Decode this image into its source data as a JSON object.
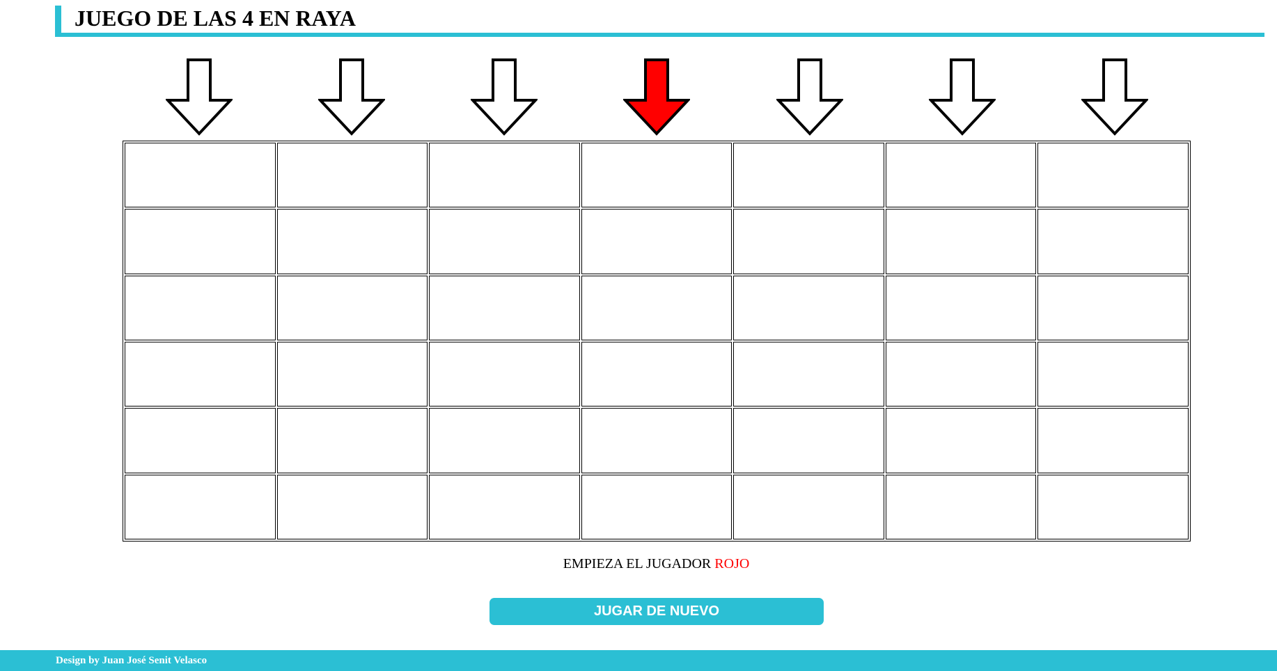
{
  "title": "JUEGO DE LAS 4 EN RAYA",
  "columns": [
    {
      "arrow": "down-arrow-icon",
      "selected": false
    },
    {
      "arrow": "down-arrow-icon",
      "selected": false
    },
    {
      "arrow": "down-arrow-icon",
      "selected": false
    },
    {
      "arrow": "down-arrow-icon",
      "selected": true
    },
    {
      "arrow": "down-arrow-icon",
      "selected": false
    },
    {
      "arrow": "down-arrow-icon",
      "selected": false
    },
    {
      "arrow": "down-arrow-icon",
      "selected": false
    }
  ],
  "board": {
    "rows": 6,
    "cols": 7,
    "cells": [
      [
        "",
        "",
        "",
        "",
        "",
        "",
        ""
      ],
      [
        "",
        "",
        "",
        "",
        "",
        "",
        ""
      ],
      [
        "",
        "",
        "",
        "",
        "",
        "",
        ""
      ],
      [
        "",
        "",
        "",
        "",
        "",
        "",
        ""
      ],
      [
        "",
        "",
        "",
        "",
        "",
        "",
        ""
      ],
      [
        "",
        "",
        "",
        "",
        "",
        "",
        ""
      ]
    ]
  },
  "status": {
    "prefix": "EMPIEZA EL JUGADOR ",
    "player": "ROJO"
  },
  "button": {
    "label": "JUGAR DE NUEVO"
  },
  "footer": {
    "credit": "Design by Juan José Senit Velasco"
  },
  "colors": {
    "accent": "#2bbfd4",
    "selected_arrow": "#ff0000",
    "arrow_default": "#ffffff",
    "player_text": "#ff0000"
  }
}
